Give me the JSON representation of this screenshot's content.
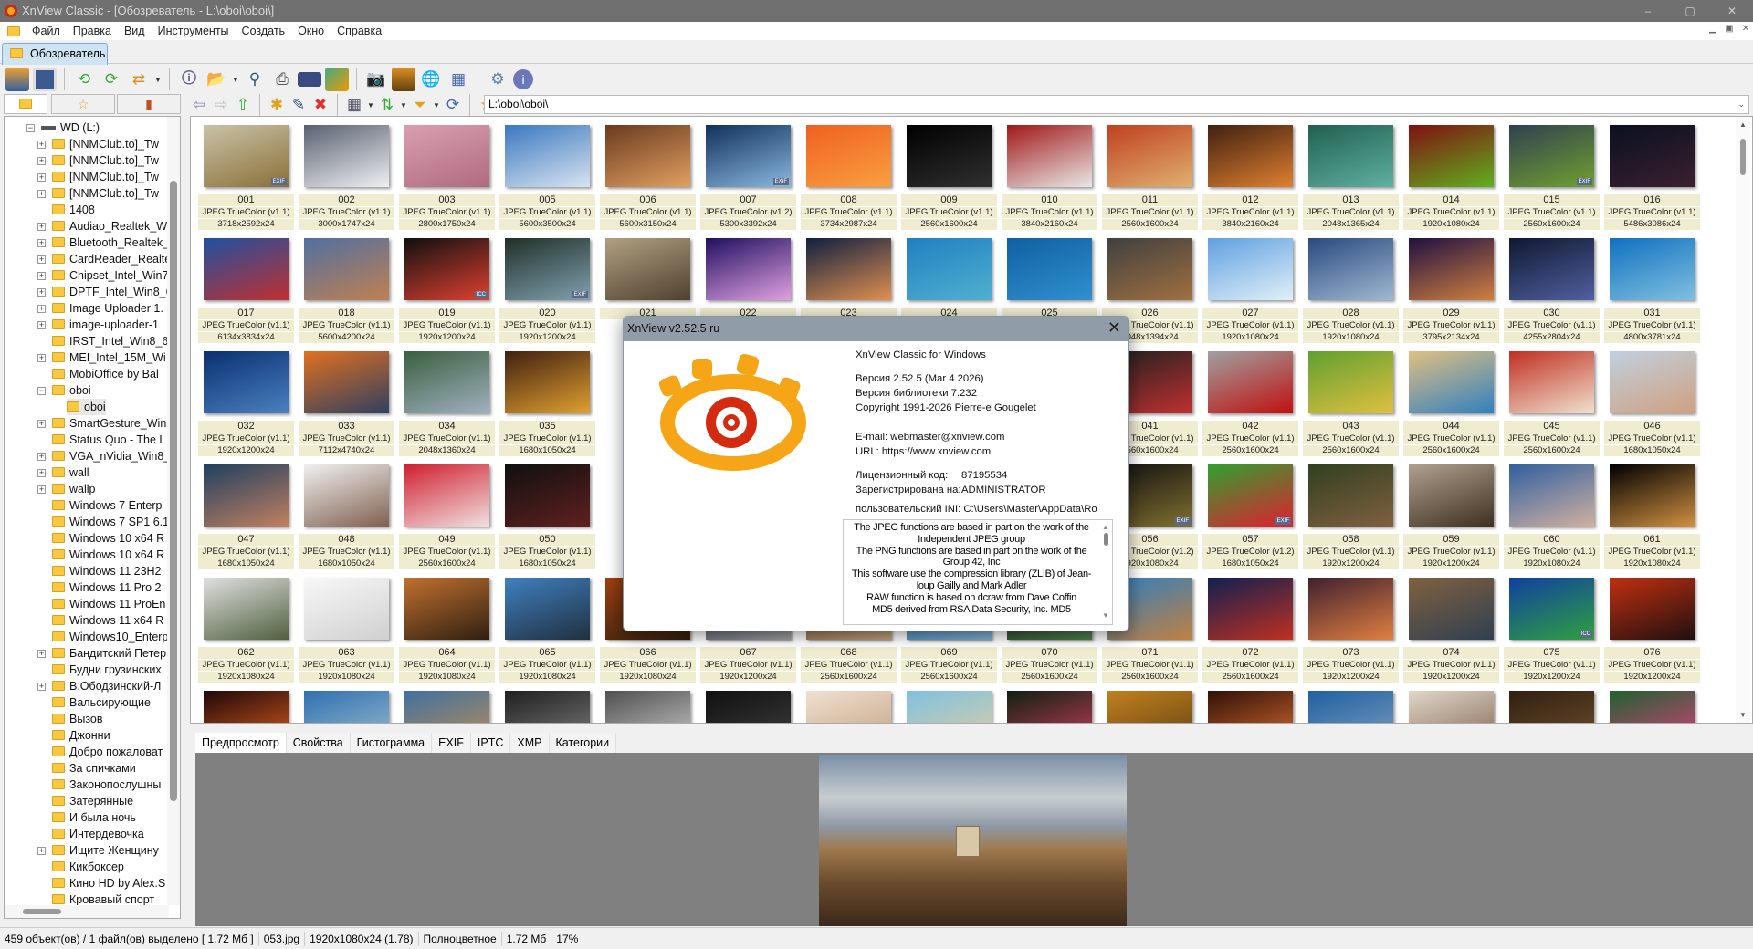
{
  "window": {
    "title": "XnView Classic - [Обозреватель - L:\\oboi\\oboi\\]",
    "minimize": "–",
    "maximize": "▢",
    "close": "✕"
  },
  "menu": [
    "Файл",
    "Правка",
    "Вид",
    "Инструменты",
    "Создать",
    "Окно",
    "Справка"
  ],
  "tab": {
    "label": "Обозреватель"
  },
  "address": {
    "value": "L:\\oboi\\oboi\\"
  },
  "tree": {
    "drive": "WD (L:)",
    "items": [
      {
        "label": "[NNMClub.to]_Tw",
        "exp": true
      },
      {
        "label": "[NNMClub.to]_Tw",
        "exp": true
      },
      {
        "label": "[NNMClub.to]_Tw",
        "exp": true
      },
      {
        "label": "[NNMClub.to]_Tw",
        "exp": true
      },
      {
        "label": "1408",
        "exp": false
      },
      {
        "label": "Audiao_Realtek_W",
        "exp": true
      },
      {
        "label": "Bluetooth_Realtek_",
        "exp": true
      },
      {
        "label": "CardReader_Realte",
        "exp": true
      },
      {
        "label": "Chipset_Intel_Win7",
        "exp": true
      },
      {
        "label": "DPTF_Intel_Win8_6",
        "exp": true
      },
      {
        "label": "Image Uploader 1.",
        "exp": true
      },
      {
        "label": "image-uploader-1",
        "exp": true
      },
      {
        "label": "IRST_Intel_Win8_64",
        "exp": false
      },
      {
        "label": "MEI_Intel_15M_Wi",
        "exp": true
      },
      {
        "label": "MobiOffice by Bal",
        "exp": false
      },
      {
        "label": "oboi",
        "exp": "open"
      },
      {
        "label": "oboi",
        "exp": false,
        "child": true,
        "selected": true
      },
      {
        "label": "SmartGesture_Win",
        "exp": true
      },
      {
        "label": "Status Quo - The L",
        "exp": false
      },
      {
        "label": "VGA_nVidia_Win8_",
        "exp": true
      },
      {
        "label": "wall",
        "exp": true
      },
      {
        "label": "wallp",
        "exp": true
      },
      {
        "label": "Windows 7 Enterp",
        "exp": false
      },
      {
        "label": "Windows 7 SP1 6.1",
        "exp": false
      },
      {
        "label": "Windows 10 x64 R",
        "exp": false
      },
      {
        "label": "Windows 10 x64 R",
        "exp": false
      },
      {
        "label": "Windows 11 23H2",
        "exp": false
      },
      {
        "label": "Windows 11 Pro 2",
        "exp": false
      },
      {
        "label": "Windows 11 ProEn",
        "exp": false
      },
      {
        "label": "Windows 11 x64 R",
        "exp": false
      },
      {
        "label": "Windows10_Enterp",
        "exp": false
      },
      {
        "label": "Бандитский Петер",
        "exp": true
      },
      {
        "label": "Будни грузинских",
        "exp": false
      },
      {
        "label": "В.Ободзинский-Л",
        "exp": true
      },
      {
        "label": "Вальсирующие",
        "exp": false
      },
      {
        "label": "Вызов",
        "exp": false
      },
      {
        "label": "Джонни",
        "exp": false
      },
      {
        "label": "Добро пожаловат",
        "exp": false
      },
      {
        "label": "За спичками",
        "exp": false
      },
      {
        "label": "Законопослушны",
        "exp": false
      },
      {
        "label": "Затерянные",
        "exp": false
      },
      {
        "label": "И была ночь",
        "exp": false
      },
      {
        "label": "Интердевочка",
        "exp": false
      },
      {
        "label": "Ищите Женщину",
        "exp": true
      },
      {
        "label": "Кикбоксер",
        "exp": false
      },
      {
        "label": "Кино HD by Alex.S",
        "exp": false
      },
      {
        "label": "Кровавый спорт",
        "exp": false
      }
    ]
  },
  "thumbs": [
    [
      {
        "n": "001",
        "f": "JPEG TrueColor (v1.1)",
        "d": "3718x2592x24",
        "c": [
          "#c9c2a8",
          "#8a7038"
        ],
        "b": "EXIF"
      },
      {
        "n": "002",
        "f": "JPEG TrueColor (v1.1)",
        "d": "3000x1747x24",
        "c": [
          "#5a6070",
          "#eef0f2"
        ]
      },
      {
        "n": "003",
        "f": "JPEG TrueColor (v1.1)",
        "d": "2800x1750x24",
        "c": [
          "#d8a0b0",
          "#b06a80"
        ]
      },
      {
        "n": "005",
        "f": "JPEG TrueColor (v1.1)",
        "d": "5600x3500x24",
        "c": [
          "#3a78c0",
          "#d8e4f0"
        ]
      },
      {
        "n": "006",
        "f": "JPEG TrueColor (v1.1)",
        "d": "5600x3150x24",
        "c": [
          "#6a3a20",
          "#e0a060"
        ]
      },
      {
        "n": "007",
        "f": "JPEG TrueColor (v1.2)",
        "d": "5300x3392x24",
        "c": [
          "#10305a",
          "#8ab8e0"
        ],
        "b": "EXIF"
      },
      {
        "n": "008",
        "f": "JPEG TrueColor (v1.1)",
        "d": "3734x2987x24",
        "c": [
          "#f06020",
          "#f8a040"
        ]
      },
      {
        "n": "009",
        "f": "JPEG TrueColor (v1.1)",
        "d": "2560x1600x24",
        "c": [
          "#000000",
          "#303030"
        ]
      },
      {
        "n": "010",
        "f": "JPEG TrueColor (v1.1)",
        "d": "3840x2160x24",
        "c": [
          "#a01818",
          "#e8e8e8"
        ]
      },
      {
        "n": "011",
        "f": "JPEG TrueColor (v1.1)",
        "d": "2560x1600x24",
        "c": [
          "#c04020",
          "#e0b070"
        ]
      },
      {
        "n": "012",
        "f": "JPEG TrueColor (v1.1)",
        "d": "3840x2160x24",
        "c": [
          "#402010",
          "#e08030"
        ]
      },
      {
        "n": "013",
        "f": "JPEG TrueColor (v1.1)",
        "d": "2048x1365x24",
        "c": [
          "#206050",
          "#60b0a0"
        ]
      },
      {
        "n": "014",
        "f": "JPEG TrueColor (v1.1)",
        "d": "1920x1080x24",
        "c": [
          "#801010",
          "#60b020"
        ]
      },
      {
        "n": "015",
        "f": "JPEG TrueColor (v1.1)",
        "d": "2560x1600x24",
        "c": [
          "#304050",
          "#70a030"
        ],
        "b": "EXIF"
      },
      {
        "n": "016",
        "f": "JPEG TrueColor (v1.1)",
        "d": "5486x3086x24",
        "c": [
          "#0a1020",
          "#3a2030"
        ]
      }
    ],
    [
      {
        "n": "017",
        "f": "JPEG TrueColor (v1.1)",
        "d": "6134x3834x24",
        "c": [
          "#2050a0",
          "#c03030"
        ]
      },
      {
        "n": "018",
        "f": "JPEG TrueColor (v1.1)",
        "d": "5600x4200x24",
        "c": [
          "#5070a0",
          "#c08050"
        ]
      },
      {
        "n": "019",
        "f": "JPEG TrueColor (v1.1)",
        "d": "1920x1200x24",
        "c": [
          "#101010",
          "#e04030"
        ],
        "b": "ICC"
      },
      {
        "n": "020",
        "f": "JPEG TrueColor (v1.1)",
        "d": "1920x1200x24",
        "c": [
          "#203028",
          "#80a0b0"
        ],
        "b": "EXIF"
      },
      {
        "n": "021",
        "c": [
          "#b0a080",
          "#504030"
        ]
      },
      {
        "n": "022",
        "c": [
          "#201060",
          "#e0a0e0"
        ]
      },
      {
        "n": "023",
        "c": [
          "#102040",
          "#e09050"
        ]
      },
      {
        "n": "024",
        "c": [
          "#2080c0",
          "#50b0d0"
        ]
      },
      {
        "n": "025",
        "c": [
          "#1060a0",
          "#3090d0"
        ]
      },
      {
        "n": "026",
        "f": "JPEG TrueColor (v1.1)",
        "d": "2048x1394x24",
        "c": [
          "#404040",
          "#a07040"
        ]
      },
      {
        "n": "027",
        "f": "JPEG TrueColor (v1.1)",
        "d": "1920x1080x24",
        "c": [
          "#60a0e0",
          "#e0f0f8"
        ]
      },
      {
        "n": "028",
        "f": "JPEG TrueColor (v1.1)",
        "d": "1920x1080x24",
        "c": [
          "#2a4a80",
          "#a0b8d0"
        ]
      },
      {
        "n": "029",
        "f": "JPEG TrueColor (v1.1)",
        "d": "3795x2134x24",
        "c": [
          "#201040",
          "#d08040"
        ]
      },
      {
        "n": "030",
        "f": "JPEG TrueColor (v1.1)",
        "d": "4255x2804x24",
        "c": [
          "#101830",
          "#5060a0"
        ]
      },
      {
        "n": "031",
        "f": "JPEG TrueColor (v1.1)",
        "d": "4800x3781x24",
        "c": [
          "#1070c0",
          "#80c0e0"
        ]
      }
    ],
    [
      {
        "n": "032",
        "f": "JPEG TrueColor (v1.1)",
        "d": "1920x1200x24",
        "c": [
          "#0a3070",
          "#4a80c0"
        ]
      },
      {
        "n": "033",
        "f": "JPEG TrueColor (v1.1)",
        "d": "7112x4740x24",
        "c": [
          "#e07020",
          "#304060"
        ]
      },
      {
        "n": "034",
        "f": "JPEG TrueColor (v1.1)",
        "d": "2048x1360x24",
        "c": [
          "#3a6040",
          "#a0b0c0"
        ]
      },
      {
        "n": "035",
        "f": "JPEG TrueColor (v1.1)",
        "d": "1680x1050x24",
        "c": [
          "#402010",
          "#e0a030"
        ]
      },
      {},
      {},
      {},
      {},
      {},
      {
        "n": "041",
        "f": "JPEG TrueColor (v1.1)",
        "d": "2560x1600x24",
        "c": [
          "#202020",
          "#c03030"
        ]
      },
      {
        "n": "042",
        "f": "JPEG TrueColor (v1.1)",
        "d": "2560x1600x24",
        "c": [
          "#a0a0a0",
          "#c01010"
        ]
      },
      {
        "n": "043",
        "f": "JPEG TrueColor (v1.1)",
        "d": "2560x1600x24",
        "c": [
          "#60a030",
          "#e0c040"
        ]
      },
      {
        "n": "044",
        "f": "JPEG TrueColor (v1.1)",
        "d": "2560x1600x24",
        "c": [
          "#e0c080",
          "#3080c0"
        ]
      },
      {
        "n": "045",
        "f": "JPEG TrueColor (v1.1)",
        "d": "2560x1600x24",
        "c": [
          "#c03020",
          "#f0e0d0"
        ]
      },
      {
        "n": "046",
        "f": "JPEG TrueColor (v1.1)",
        "d": "1680x1050x24",
        "c": [
          "#c0d0e0",
          "#d0a080"
        ]
      }
    ],
    [
      {
        "n": "047",
        "f": "JPEG TrueColor (v1.1)",
        "d": "1680x1050x24",
        "c": [
          "#204060",
          "#c08060"
        ]
      },
      {
        "n": "048",
        "f": "JPEG TrueColor (v1.1)",
        "d": "1680x1050x24",
        "c": [
          "#f0f0f0",
          "#806050"
        ]
      },
      {
        "n": "049",
        "f": "JPEG TrueColor (v1.1)",
        "d": "2560x1600x24",
        "c": [
          "#d02030",
          "#f0e0e0"
        ]
      },
      {
        "n": "050",
        "f": "JPEG TrueColor (v1.1)",
        "d": "1680x1050x24",
        "c": [
          "#101010",
          "#602020"
        ]
      },
      {},
      {},
      {},
      {},
      {},
      {
        "n": "056",
        "f": "JPEG TrueColor (v1.2)",
        "d": "1920x1080x24",
        "c": [
          "#101010",
          "#807030"
        ],
        "b": "EXIF"
      },
      {
        "n": "057",
        "f": "JPEG TrueColor (v1.2)",
        "d": "1680x1050x24",
        "c": [
          "#30a030",
          "#e02030"
        ],
        "b": "EXIF"
      },
      {
        "n": "058",
        "f": "JPEG TrueColor (v1.1)",
        "d": "1920x1200x24",
        "c": [
          "#304020",
          "#806040"
        ]
      },
      {
        "n": "059",
        "f": "JPEG TrueColor (v1.1)",
        "d": "1920x1200x24",
        "c": [
          "#b0a090",
          "#403020"
        ]
      },
      {
        "n": "060",
        "f": "JPEG TrueColor (v1.1)",
        "d": "1920x1080x24",
        "c": [
          "#3060a0",
          "#d0b0a0"
        ]
      },
      {
        "n": "061",
        "f": "JPEG TrueColor (v1.1)",
        "d": "1920x1080x24",
        "c": [
          "#000000",
          "#d09040"
        ]
      }
    ],
    [
      {
        "n": "062",
        "f": "JPEG TrueColor (v1.1)",
        "d": "1920x1080x24",
        "c": [
          "#e0e0e0",
          "#506040"
        ]
      },
      {
        "n": "063",
        "f": "JPEG TrueColor (v1.1)",
        "d": "1920x1080x24",
        "c": [
          "#f8f8f8",
          "#d0d0d0"
        ]
      },
      {
        "n": "064",
        "f": "JPEG TrueColor (v1.1)",
        "d": "1920x1080x24",
        "c": [
          "#c07030",
          "#302010"
        ]
      },
      {
        "n": "065",
        "f": "JPEG TrueColor (v1.1)",
        "d": "1920x1080x24",
        "c": [
          "#4080c0",
          "#203040"
        ]
      },
      {
        "n": "066",
        "f": "JPEG TrueColor (v1.1)",
        "d": "1920x1080x24",
        "c": [
          "#a04010",
          "#302010"
        ]
      },
      {
        "n": "067",
        "f": "JPEG TrueColor (v1.1)",
        "d": "1920x1200x24",
        "c": [
          "#203050",
          "#a0a0a0"
        ]
      },
      {
        "n": "068",
        "f": "JPEG TrueColor (v1.1)",
        "d": "2560x1600x24",
        "c": [
          "#604020",
          "#c0a080"
        ]
      },
      {
        "n": "069",
        "f": "JPEG TrueColor (v1.1)",
        "d": "2560x1600x24",
        "c": [
          "#2060a0",
          "#80b0d0"
        ]
      },
      {
        "n": "070",
        "f": "JPEG TrueColor (v1.1)",
        "d": "2560x1600x24",
        "c": [
          "#101810",
          "#508050"
        ]
      },
      {
        "n": "071",
        "f": "JPEG TrueColor (v1.1)",
        "d": "2560x1600x24",
        "c": [
          "#3080c0",
          "#c08040"
        ]
      },
      {
        "n": "072",
        "f": "JPEG TrueColor (v1.1)",
        "d": "2560x1600x24",
        "c": [
          "#102050",
          "#c03020"
        ]
      },
      {
        "n": "073",
        "f": "JPEG TrueColor (v1.1)",
        "d": "1920x1200x24",
        "c": [
          "#402030",
          "#e08040"
        ]
      },
      {
        "n": "074",
        "f": "JPEG TrueColor (v1.1)",
        "d": "1920x1200x24",
        "c": [
          "#806040",
          "#304050"
        ]
      },
      {
        "n": "075",
        "f": "JPEG TrueColor (v1.1)",
        "d": "1920x1200x24",
        "c": [
          "#1040a0",
          "#30a040"
        ],
        "b": "ICC"
      },
      {
        "n": "076",
        "f": "JPEG TrueColor (v1.1)",
        "d": "1920x1200x24",
        "c": [
          "#c03010",
          "#201010"
        ]
      }
    ],
    [
      {
        "c": [
          "#200808",
          "#e06020"
        ]
      },
      {
        "c": [
          "#3070b0",
          "#a0c0d0"
        ]
      },
      {
        "c": [
          "#4070a0",
          "#c09050"
        ]
      },
      {
        "c": [
          "#202020",
          "#808080"
        ]
      },
      {
        "c": [
          "#505050",
          "#d0d0d0"
        ]
      },
      {
        "c": [
          "#101010",
          "#404040"
        ]
      },
      {
        "c": [
          "#f0e0d0",
          "#c0a080"
        ]
      },
      {
        "c": [
          "#80c0e0",
          "#e0d0a0"
        ]
      },
      {
        "c": [
          "#102010",
          "#d04060"
        ]
      },
      {
        "c": [
          "#c08020",
          "#604010"
        ]
      },
      {
        "c": [
          "#301008",
          "#e07030"
        ]
      },
      {
        "c": [
          "#2060a0",
          "#80a0c0"
        ]
      },
      {
        "c": [
          "#e0d8c8",
          "#806050"
        ]
      },
      {
        "c": [
          "#302010",
          "#705030"
        ]
      },
      {
        "c": [
          "#206030",
          "#e04080"
        ]
      }
    ]
  ],
  "bottom_tabs": [
    "Предпросмотр",
    "Свойства",
    "Гистограмма",
    "EXIF",
    "IPTC",
    "XMP",
    "Категории"
  ],
  "status": [
    "459 объект(ов) / 1 файл(ов) выделено  [ 1.72 Мб ]",
    "053.jpg",
    "1920x1080x24 (1.78)",
    "Полноцветное",
    "1.72 Мб",
    "17%"
  ],
  "about": {
    "title": "XnView v2.52.5 ru",
    "product": "XnView Classic for Windows",
    "version": "Версия 2.52.5 (Mar  4 2026)",
    "lib_version": "Версия библиотеки 7.232",
    "copyright": "Copyright 1991-2026 Pierre-e Gougelet",
    "email": "E-mail: webmaster@xnview.com",
    "url": "URL: https://www.xnview.com",
    "license_label": "Лицензионный код:",
    "license_value": "87195534",
    "registered_label": "Зарегистрирована на:",
    "registered_value": "ADMINISTRATOR",
    "ini": "пользовательский INI: C:\\Users\\Master\\AppData\\Ro",
    "credits": [
      "The JPEG functions are based in part on the work of the Independent JPEG group",
      "The PNG functions are based in part on the work of the Group 42, Inc",
      "This software use the compression library (ZLIB) of Jean-loup Gailly and Mark Adler",
      "RAW function is based on dcraw from Dave Coffin",
      "MD5 derived from RSA Data Security, Inc. MD5"
    ],
    "close": "✕"
  }
}
